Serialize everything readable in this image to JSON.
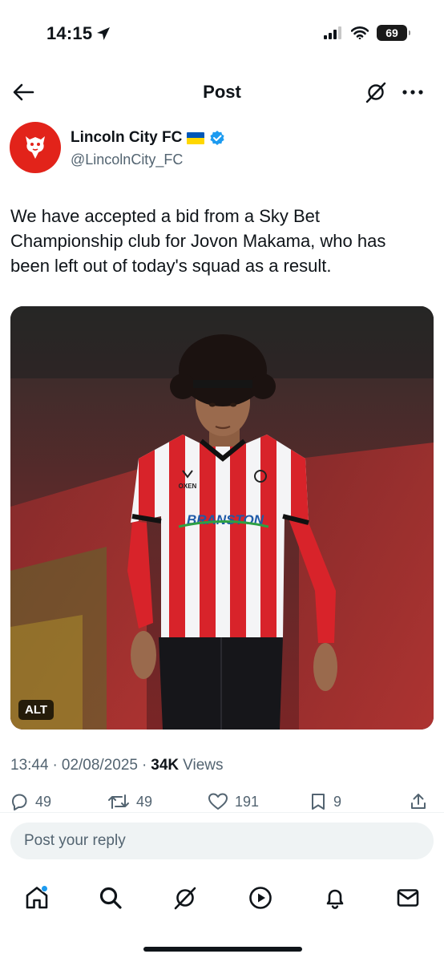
{
  "status_bar": {
    "time": "14:15",
    "battery": "69"
  },
  "header": {
    "title": "Post"
  },
  "author": {
    "name": "Lincoln City FC",
    "handle": "@LincolnCity_FC"
  },
  "tweet": {
    "text": "We have accepted a bid from a Sky Bet Championship club for Jovon Makama, who has been left out of today's squad as a result.",
    "image_alt_badge": "ALT",
    "shirt_sponsor": "BRANSTON",
    "kit_maker": "OXEN"
  },
  "meta": {
    "time": "13:44",
    "separator": "·",
    "date": "02/08/2025",
    "separator2": "·",
    "views_count": "34K",
    "views_label": "Views"
  },
  "actions": {
    "replies": "49",
    "reposts": "49",
    "likes": "191",
    "bookmarks": "9"
  },
  "reply_box": {
    "placeholder": "Post your reply"
  },
  "colors": {
    "accent": "#1d9bf0",
    "club_red": "#e2231a",
    "muted_text": "#536471"
  }
}
